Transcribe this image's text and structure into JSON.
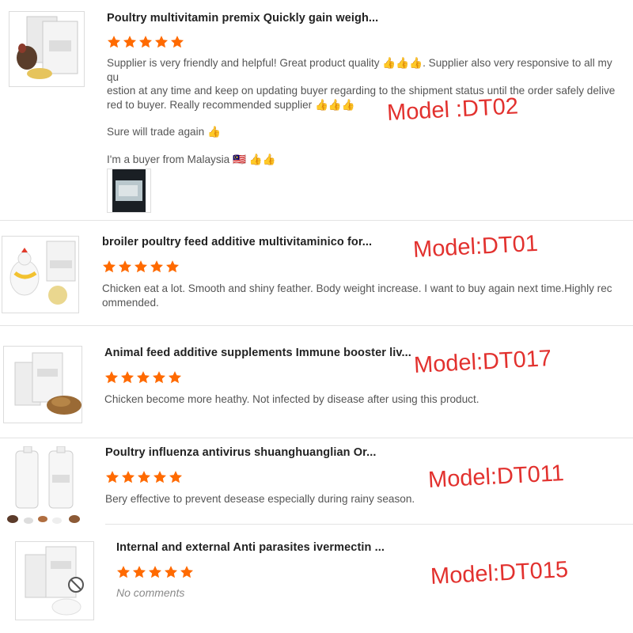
{
  "reviews": [
    {
      "title": "Poultry multivitamin premix Quickly gain weigh...",
      "rating": 5,
      "lines": [
        "Supplier is very friendly and helpful! Great product quality 👍👍👍. Supplier also very responsive to all my qu",
        "estion at any time and keep on updating buyer regarding to the shipment status until the order safely delive",
        "red to buyer. Really recommended supplier 👍👍👍"
      ],
      "line2": "Sure will trade again 👍",
      "line3": "I'm a buyer from Malaysia 🇲🇾 👍👍",
      "model": "Model :DT02"
    },
    {
      "title": "broiler poultry feed additive multivitaminico for...",
      "rating": 5,
      "lines": [
        "Chicken eat a lot. Smooth and shiny feather. Body weight increase. I want to buy again next time.Highly rec",
        "ommended."
      ],
      "model": "Model:DT01"
    },
    {
      "title": "Animal feed additive supplements Immune booster liv...",
      "rating": 5,
      "lines": [
        "Chicken become more heathy. Not infected by disease after using this product."
      ],
      "model": "Model:DT017"
    },
    {
      "title": "Poultry influenza antivirus shuanghuanglian Or...",
      "rating": 5,
      "lines": [
        "Bery effective to prevent desease especially during rainy season."
      ],
      "model": "Model:DT011"
    },
    {
      "title": "Internal and external Anti parasites ivermectin ...",
      "rating": 5,
      "no_comments": "No comments",
      "model": "Model:DT015"
    }
  ],
  "colors": {
    "star": "#ff6a00",
    "model_text": "#e2312e"
  }
}
